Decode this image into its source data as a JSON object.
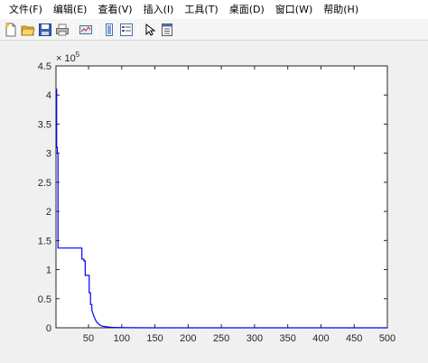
{
  "menubar": {
    "items": [
      {
        "label": "文件(F)"
      },
      {
        "label": "编辑(E)"
      },
      {
        "label": "查看(V)"
      },
      {
        "label": "插入(I)"
      },
      {
        "label": "工具(T)"
      },
      {
        "label": "桌面(D)"
      },
      {
        "label": "窗口(W)"
      },
      {
        "label": "帮助(H)"
      }
    ]
  },
  "toolbar": {
    "buttons": [
      "new-file-icon",
      "open-folder-icon",
      "save-icon",
      "print-icon",
      "print-preview-icon",
      "link-plot-icon",
      "insert-colorbar-icon",
      "edit-plot-cursor-icon",
      "property-inspector-icon"
    ]
  },
  "chart_data": {
    "type": "line",
    "title": "",
    "xlabel": "",
    "ylabel": "",
    "xlim": [
      1,
      500
    ],
    "ylim": [
      0,
      450000
    ],
    "y_exponent_label": "× 10^5",
    "x_ticks": [
      50,
      100,
      150,
      200,
      250,
      300,
      350,
      400,
      450,
      500
    ],
    "x_tick_labels": [
      "50",
      "100",
      "150",
      "200",
      "250",
      "300",
      "350",
      "400",
      "450",
      "500"
    ],
    "y_ticks": [
      0,
      50000,
      100000,
      150000,
      200000,
      250000,
      300000,
      350000,
      400000,
      450000
    ],
    "y_tick_labels": [
      "0",
      "0.5",
      "1",
      "1.5",
      "2",
      "2.5",
      "3",
      "3.5",
      "4",
      "4.5"
    ],
    "exponent_base": "× 10",
    "exponent_power": "5",
    "grid": false,
    "color": "#0000ff",
    "series": [
      {
        "x": [
          1,
          2,
          2,
          3,
          3,
          4,
          4,
          40,
          40,
          43,
          43,
          45,
          45,
          51,
          51,
          53,
          53,
          55,
          55,
          58,
          60,
          62,
          65,
          68,
          72,
          78,
          85,
          95,
          110,
          150,
          500
        ],
        "y": [
          410000,
          410000,
          310000,
          310000,
          300000,
          300000,
          137000,
          137000,
          118000,
          118000,
          115000,
          115000,
          90000,
          90000,
          60000,
          60000,
          40000,
          40000,
          30000,
          20000,
          15000,
          10000,
          7000,
          4000,
          2500,
          1500,
          800,
          400,
          150,
          50,
          0
        ]
      }
    ]
  }
}
